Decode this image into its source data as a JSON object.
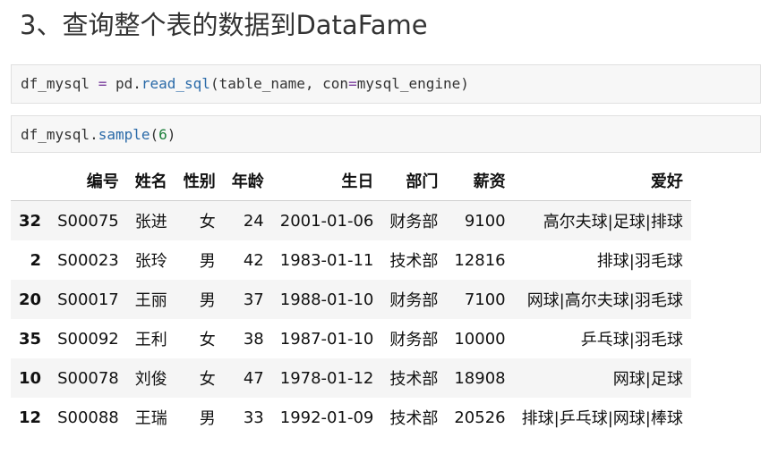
{
  "heading": "3、查询整个表的数据到DataFame",
  "cells": [
    {
      "tokens": [
        {
          "text": "df_mysql ",
          "kind": "plain"
        },
        {
          "text": "=",
          "kind": "op"
        },
        {
          "text": " pd.",
          "kind": "plain"
        },
        {
          "text": "read_sql",
          "kind": "fn"
        },
        {
          "text": "(table_name, con",
          "kind": "plain"
        },
        {
          "text": "=",
          "kind": "op"
        },
        {
          "text": "mysql_engine)",
          "kind": "plain"
        }
      ]
    },
    {
      "tokens": [
        {
          "text": "df_mysql.",
          "kind": "plain"
        },
        {
          "text": "sample",
          "kind": "fn"
        },
        {
          "text": "(",
          "kind": "plain"
        },
        {
          "text": "6",
          "kind": "num"
        },
        {
          "text": ")",
          "kind": "plain"
        }
      ]
    }
  ],
  "table": {
    "columns": [
      "",
      "编号",
      "姓名",
      "性别",
      "年龄",
      "生日",
      "部门",
      "薪资",
      "爱好"
    ],
    "rows": [
      {
        "index": "32",
        "cells": [
          "S00075",
          "张进",
          "女",
          "24",
          "2001-01-06",
          "财务部",
          "9100",
          "高尔夫球|足球|排球"
        ]
      },
      {
        "index": "2",
        "cells": [
          "S00023",
          "张玲",
          "男",
          "42",
          "1983-01-11",
          "技术部",
          "12816",
          "排球|羽毛球"
        ]
      },
      {
        "index": "20",
        "cells": [
          "S00017",
          "王丽",
          "男",
          "37",
          "1988-01-10",
          "财务部",
          "7100",
          "网球|高尔夫球|羽毛球"
        ]
      },
      {
        "index": "35",
        "cells": [
          "S00092",
          "王利",
          "女",
          "38",
          "1987-01-10",
          "财务部",
          "10000",
          "乒乓球|羽毛球"
        ]
      },
      {
        "index": "10",
        "cells": [
          "S00078",
          "刘俊",
          "女",
          "47",
          "1978-01-12",
          "技术部",
          "18908",
          "网球|足球"
        ]
      },
      {
        "index": "12",
        "cells": [
          "S00088",
          "王瑞",
          "男",
          "33",
          "1992-01-09",
          "技术部",
          "20526",
          "排球|乒乓球|网球|棒球"
        ]
      }
    ]
  }
}
